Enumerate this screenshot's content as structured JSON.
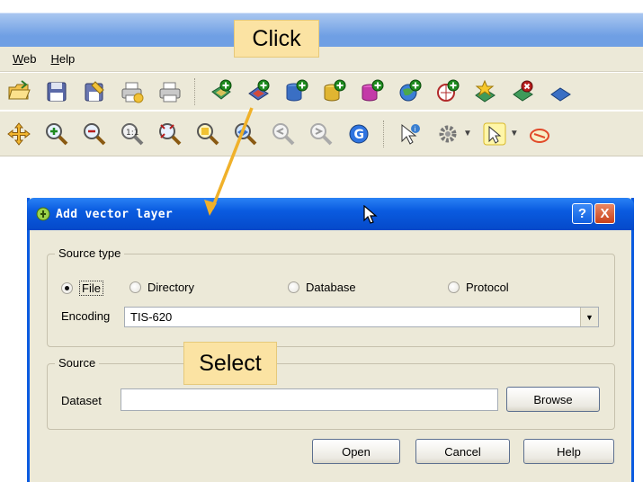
{
  "menubar": {
    "items": [
      "Web",
      "Help"
    ]
  },
  "toolbar_row1": {
    "icons": [
      "open-project-icon",
      "save-project-icon",
      "save-as-icon",
      "print-composer-icon",
      "print-icon",
      "add-vector-layer-icon",
      "add-raster-layer-icon",
      "add-postgis-layer-icon",
      "add-spatialite-layer-icon",
      "add-mssql-layer-icon",
      "add-wms-layer-icon",
      "add-wfs-layer-icon",
      "new-vector-layer-icon",
      "remove-layer-icon",
      "edit-layer-icon"
    ]
  },
  "toolbar_row2": {
    "icons": [
      "pan-icon",
      "zoom-in-icon",
      "zoom-out-icon",
      "zoom-actual-icon",
      "zoom-full-icon",
      "zoom-selection-icon",
      "zoom-layer-icon",
      "zoom-last-icon",
      "zoom-next-icon",
      "refresh-icon",
      "identify-icon",
      "settings-icon",
      "select-icon",
      "deselect-icon"
    ]
  },
  "annotations": {
    "click": "Click",
    "select": "Select"
  },
  "dialog": {
    "title": "Add vector layer",
    "help_button": "?",
    "close_button": "X",
    "source_type": {
      "legend": "Source type",
      "options": [
        {
          "label": "File",
          "checked": true
        },
        {
          "label": "Directory",
          "checked": false
        },
        {
          "label": "Database",
          "checked": false
        },
        {
          "label": "Protocol",
          "checked": false
        }
      ],
      "encoding_label": "Encoding",
      "encoding_value": "TIS-620"
    },
    "source": {
      "legend": "Source",
      "dataset_label": "Dataset",
      "dataset_value": "",
      "browse_label": "Browse"
    },
    "buttons": {
      "open": "Open",
      "cancel": "Cancel",
      "help": "Help"
    }
  },
  "colors": {
    "title_bar_blue": "#0a5be0",
    "window_face": "#ece9d8",
    "callout_fill": "#fbe3a3",
    "arrow": "#f0b12a"
  }
}
